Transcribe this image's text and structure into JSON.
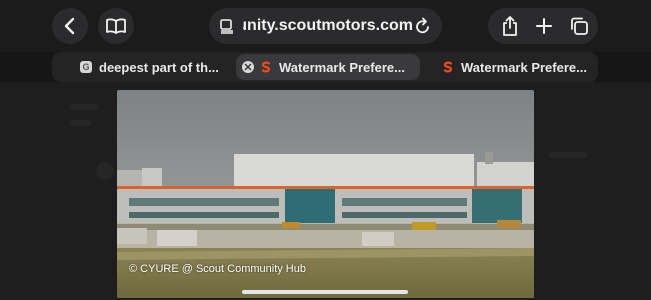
{
  "browser": {
    "address_text": "nunity.scoutmotors.com",
    "icons": {
      "back": "chevron-left-icon",
      "reader": "book-icon",
      "page_menu": "page-menu-icon",
      "reload": "reload-icon",
      "share": "share-icon",
      "new_tab": "plus-icon",
      "tabs_overview": "tabs-overview-icon"
    }
  },
  "tabs": [
    {
      "label": "deepest part of th...",
      "favicon": "G",
      "active": false
    },
    {
      "label": "Watermark Prefere...",
      "favicon": "scout-logo",
      "active": true
    },
    {
      "label": "Watermark Prefere...",
      "favicon": "scout-logo",
      "active": false
    }
  ],
  "image": {
    "caption": "© CYURE @ Scout Community Hub"
  },
  "colors": {
    "brand_orange": "#f04a1f",
    "toolbar_button": "#2b2b2d",
    "active_tab": "#3a3a3c"
  }
}
